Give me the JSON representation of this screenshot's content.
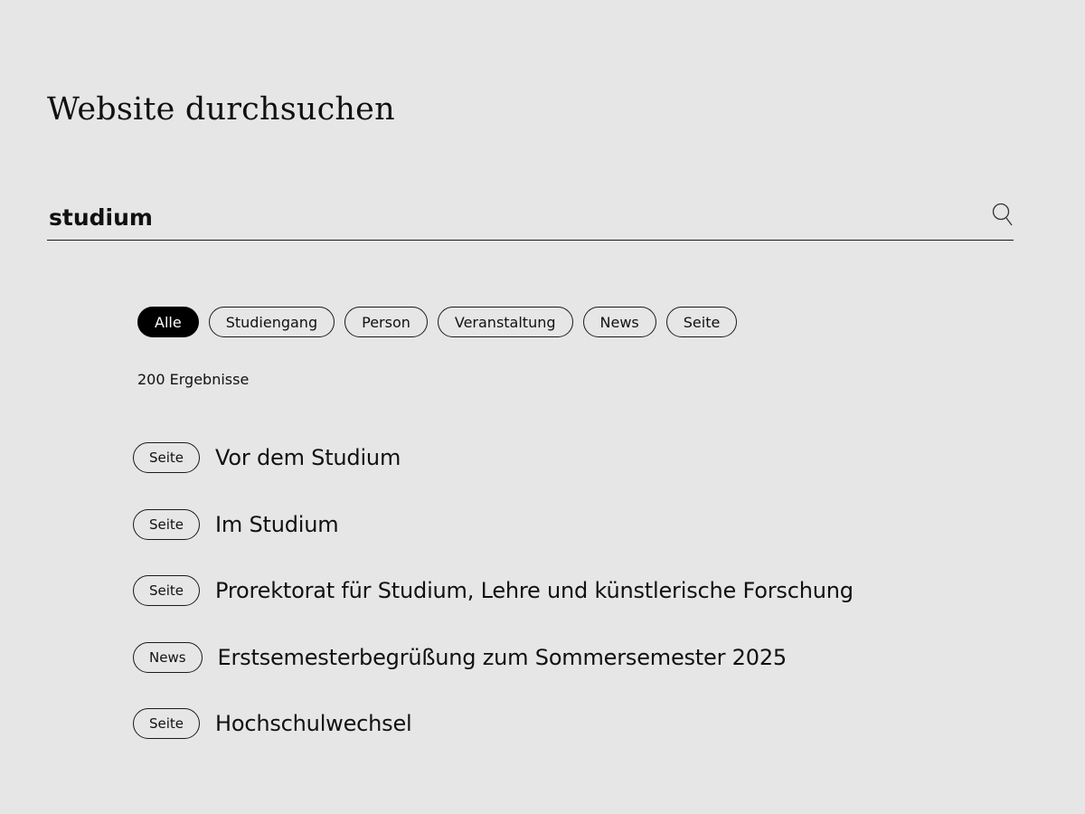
{
  "header": {
    "title": "Website durchsuchen"
  },
  "search": {
    "value": "studium",
    "icon": "search-icon"
  },
  "filters": [
    {
      "label": "Alle",
      "active": true
    },
    {
      "label": "Studiengang",
      "active": false
    },
    {
      "label": "Person",
      "active": false
    },
    {
      "label": "Veranstaltung",
      "active": false
    },
    {
      "label": "News",
      "active": false
    },
    {
      "label": "Seite",
      "active": false
    }
  ],
  "results_count": "200 Ergebnisse",
  "results": [
    {
      "tag": "Seite",
      "title": "Vor dem Studium"
    },
    {
      "tag": "Seite",
      "title": "Im Studium"
    },
    {
      "tag": "Seite",
      "title": "Prorektorat für Studium, Lehre und künstlerische Forschung"
    },
    {
      "tag": "News",
      "title": "Erstsemesterbegrüßung zum Sommersemester 2025"
    },
    {
      "tag": "Seite",
      "title": "Hochschulwechsel"
    }
  ],
  "colors": {
    "background": "#e6e6e6",
    "text": "#111111",
    "active_chip": "#000000"
  }
}
